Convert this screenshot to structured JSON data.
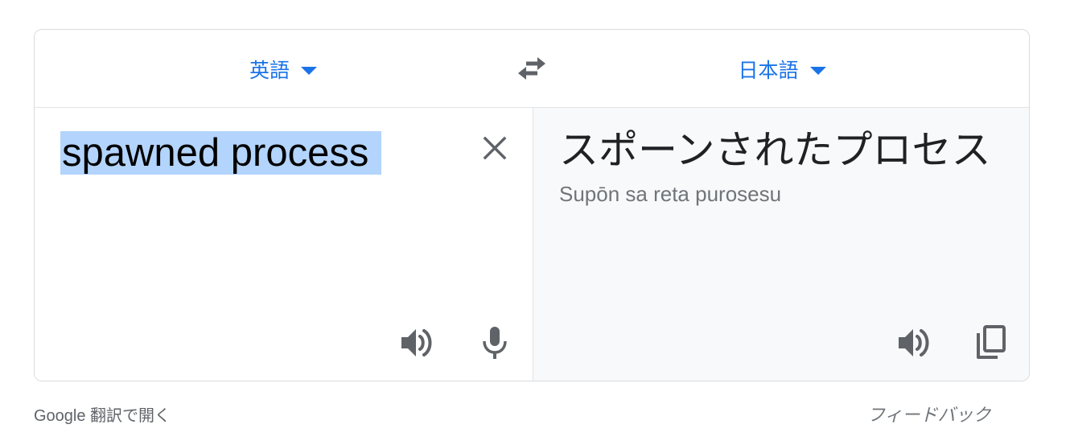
{
  "source_lang": {
    "label": "英語",
    "icon": "caret-down-icon"
  },
  "target_lang": {
    "label": "日本語",
    "icon": "caret-down-icon"
  },
  "swap": {
    "icon": "swap-arrows-icon"
  },
  "source": {
    "text": "spawned process",
    "clear_icon": "close-icon",
    "listen_icon": "speaker-icon",
    "mic_icon": "microphone-icon"
  },
  "target": {
    "text": "スポーンされたプロセス",
    "romanization": "Supōn sa reta purosesu",
    "listen_icon": "speaker-icon",
    "copy_icon": "copy-icon"
  },
  "footer": {
    "open_link": "Google 翻訳で開く",
    "feedback": "フィードバック"
  },
  "colors": {
    "accent": "#1a73e8",
    "icon": "#5f6368",
    "selection": "#b3d4fc",
    "target_bg": "#f8f9fa",
    "border": "#dadce0"
  }
}
